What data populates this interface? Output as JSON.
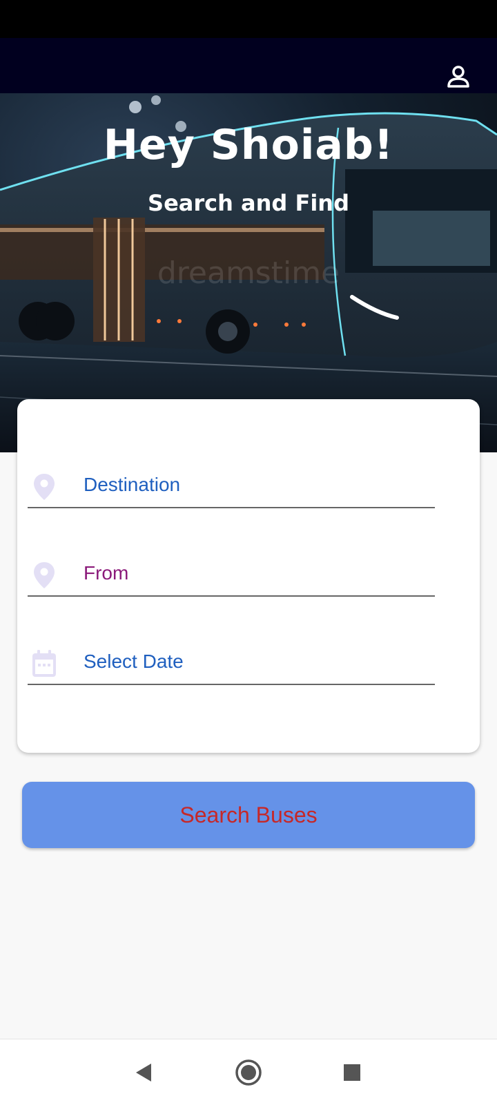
{
  "header": {
    "profile_icon": "user-icon"
  },
  "hero": {
    "greeting": "Hey Shoiab!",
    "subtitle": "Search and Find",
    "image_watermark": "dreamstime"
  },
  "form": {
    "destination": {
      "text": "Destination",
      "icon": "location-pin-icon",
      "color": "#1f5fbf"
    },
    "from": {
      "text": "From",
      "icon": "location-pin-icon",
      "color": "#8b1a7a"
    },
    "date": {
      "text": "Select Date",
      "icon": "calendar-icon",
      "color": "#1f5fbf"
    }
  },
  "search_button": {
    "label": "Search Buses",
    "bg": "#6592e8",
    "text_color": "#c62828"
  },
  "nav": {
    "back_icon": "back-triangle-icon",
    "home_icon": "home-circle-icon",
    "recents_icon": "recents-square-icon"
  },
  "colors": {
    "status_bar": "#000000",
    "app_bar": "#01001f",
    "icon_tint": "#e3dff5"
  }
}
